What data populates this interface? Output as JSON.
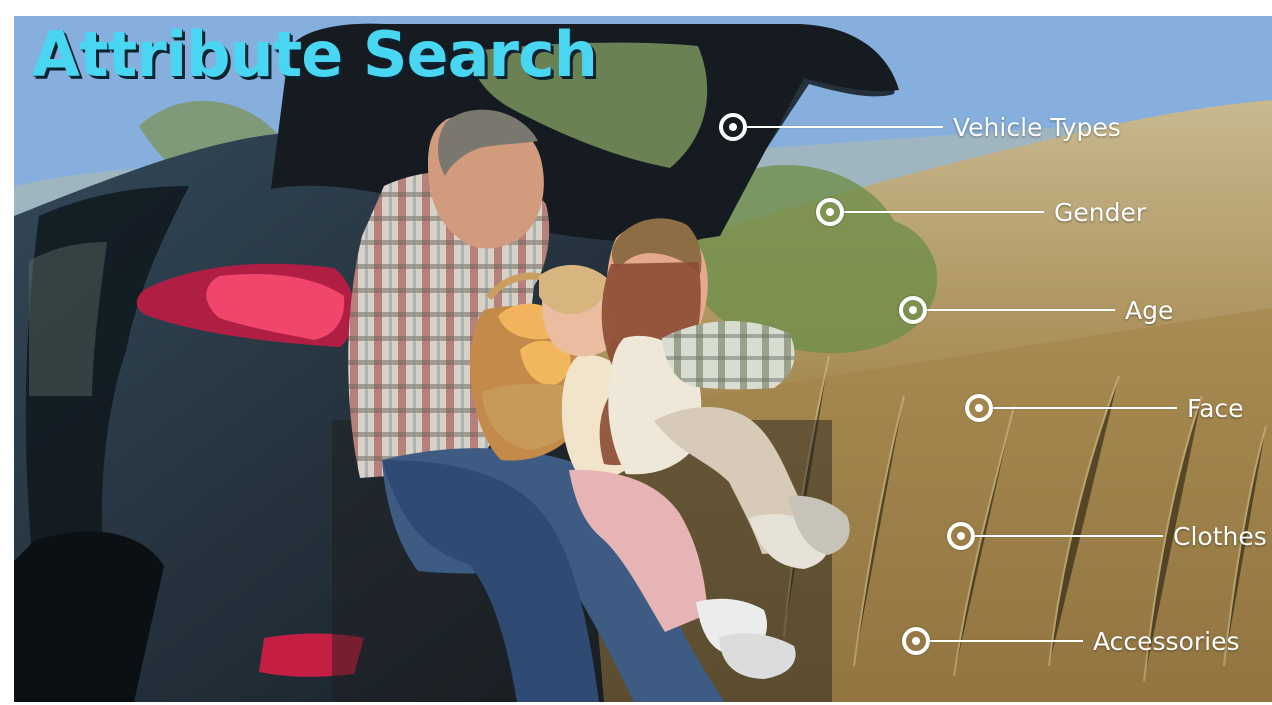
{
  "heading": {
    "title": "Attribute Search"
  },
  "attributes": [
    {
      "label": "Vehicle Types",
      "icon": "target-icon"
    },
    {
      "label": "Gender",
      "icon": "target-icon"
    },
    {
      "label": "Age",
      "icon": "target-icon"
    },
    {
      "label": "Face",
      "icon": "target-icon"
    },
    {
      "label": "Clothes",
      "icon": "target-icon"
    },
    {
      "label": "Accessories",
      "icon": "target-icon"
    }
  ],
  "colors": {
    "title": "#49d6f2",
    "callout": "#ffffff",
    "sky": "#7ea9d9",
    "hill": "#a48c56",
    "car": "#2b3945",
    "taillight": "#d22b4f"
  }
}
